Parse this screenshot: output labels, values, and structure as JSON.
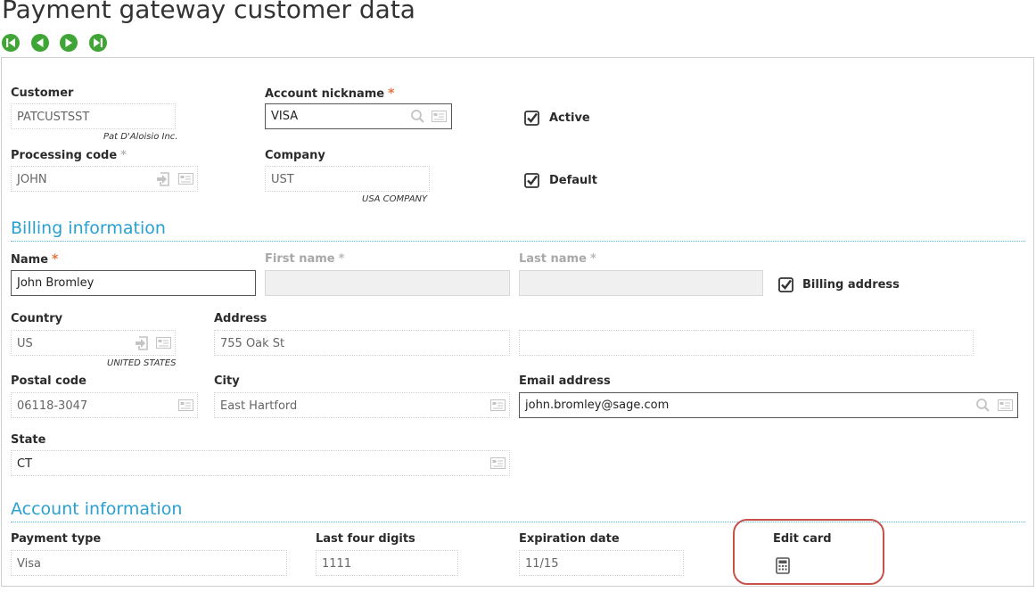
{
  "page": {
    "title": "Payment gateway customer data"
  },
  "nav": {
    "buttons": [
      {
        "name": "first-record-button"
      },
      {
        "name": "previous-record-button"
      },
      {
        "name": "next-record-button"
      },
      {
        "name": "last-record-button"
      }
    ]
  },
  "header": {
    "customer": {
      "label": "Customer",
      "value": "PATCUSTSST",
      "description": "Pat D'Aloisio Inc."
    },
    "account_nickname": {
      "label": "Account nickname",
      "required_mark": "*",
      "value": "VISA"
    },
    "active": {
      "label": "Active",
      "checked": true
    },
    "processing_code": {
      "label": "Processing code",
      "optional_mark": "*",
      "value": "JOHN"
    },
    "company": {
      "label": "Company",
      "value": "UST",
      "description": "USA COMPANY"
    },
    "default": {
      "label": "Default",
      "checked": true
    }
  },
  "billing": {
    "title": "Billing information",
    "name": {
      "label": "Name",
      "required_mark": "*",
      "value": "John Bromley"
    },
    "first_name": {
      "label": "First name",
      "optional_mark": "*",
      "value": ""
    },
    "last_name": {
      "label": "Last name",
      "optional_mark": "*",
      "value": ""
    },
    "billing_address": {
      "label": "Billing address",
      "checked": true
    },
    "country": {
      "label": "Country",
      "value": "US",
      "description": "UNITED STATES"
    },
    "address": {
      "label": "Address",
      "line1": "755 Oak St",
      "line2": ""
    },
    "postal_code": {
      "label": "Postal code",
      "value": "06118-3047"
    },
    "city": {
      "label": "City",
      "value": "East Hartford"
    },
    "email": {
      "label": "Email address",
      "value": "john.bromley@sage.com"
    },
    "state": {
      "label": "State",
      "value": "CT"
    }
  },
  "account": {
    "title": "Account information",
    "payment_type": {
      "label": "Payment type",
      "value": "Visa"
    },
    "last_four": {
      "label": "Last four digits",
      "value": "1111"
    },
    "expiration": {
      "label": "Expiration date",
      "value": "11/15"
    },
    "edit_card": {
      "label": "Edit card",
      "icon": "calculator-icon"
    }
  },
  "colors": {
    "accent": "#2aa0d0",
    "nav_green": "#3fa535",
    "required": "#e8733a",
    "highlight": "#c8524a"
  }
}
